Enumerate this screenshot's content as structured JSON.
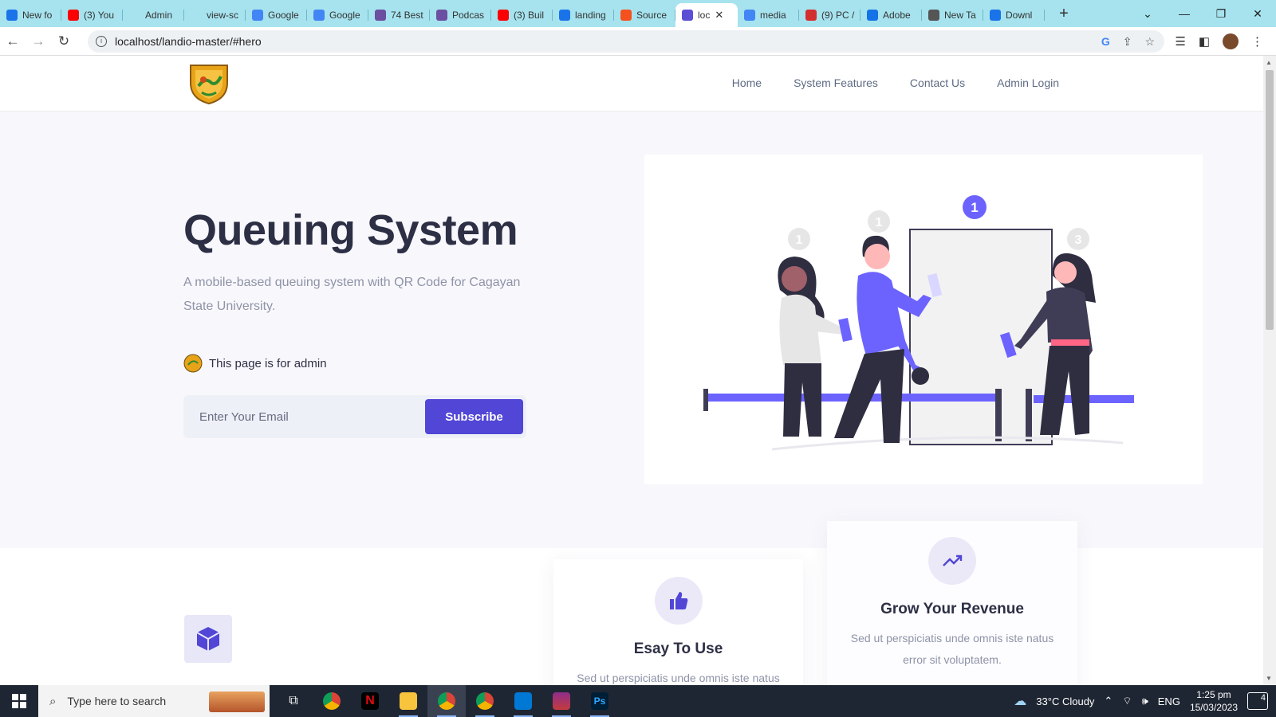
{
  "browser": {
    "tabs": [
      {
        "label": "New fo",
        "color": "#1a73e8"
      },
      {
        "label": "(3) You",
        "color": "#ff0000"
      },
      {
        "label": "Admin",
        "color": "#a6e3ee"
      },
      {
        "label": "view-sc",
        "color": "#a6e3ee"
      },
      {
        "label": "Google",
        "color": "#4285f4"
      },
      {
        "label": "Google",
        "color": "#4285f4"
      },
      {
        "label": "74 Best",
        "color": "#6b4fa0"
      },
      {
        "label": "Podcas",
        "color": "#6b4fa0"
      },
      {
        "label": "(3) Buil",
        "color": "#ff0000"
      },
      {
        "label": "landing",
        "color": "#1a73e8"
      },
      {
        "label": "Source",
        "color": "#f4511e"
      },
      {
        "label": "loc",
        "color": "#5b4fd6",
        "active": true
      },
      {
        "label": "media",
        "color": "#4285f4"
      },
      {
        "label": "(9) PC /",
        "color": "#d32f2f"
      },
      {
        "label": "Adobe",
        "color": "#1473e6"
      },
      {
        "label": "New Ta",
        "color": "#555555"
      },
      {
        "label": "Downl",
        "color": "#1a73e8"
      }
    ],
    "url": "localhost/landio-master/#hero"
  },
  "site": {
    "nav": [
      "Home",
      "System Features",
      "Contact Us",
      "Admin Login"
    ],
    "hero": {
      "title": "Queuing System",
      "description": "A mobile-based queuing system with QR Code for Cagayan State University.",
      "admin_note": "This page is for admin",
      "email_placeholder": "Enter Your Email",
      "subscribe_label": "Subscribe"
    },
    "illustration": {
      "badges": [
        "1",
        "1",
        "1",
        "3"
      ]
    },
    "features": [
      {
        "title": "Esay To Use",
        "text": "Sed ut perspiciatis unde omnis iste natus",
        "icon": "thumbs-up-icon"
      },
      {
        "title": "Grow Your Revenue",
        "text": "Sed ut perspiciatis unde omnis iste natus error sit voluptatem.",
        "icon": "trending-up-icon"
      }
    ]
  },
  "taskbar": {
    "search_placeholder": "Type here to search",
    "weather": "33°C  Cloudy",
    "lang": "ENG",
    "time": "1:25 pm",
    "date": "15/03/2023",
    "notifications": "4"
  },
  "colors": {
    "accent": "#5146d6",
    "hero_bg": "#f8f8fc",
    "tabbar": "#a6e3ee"
  }
}
